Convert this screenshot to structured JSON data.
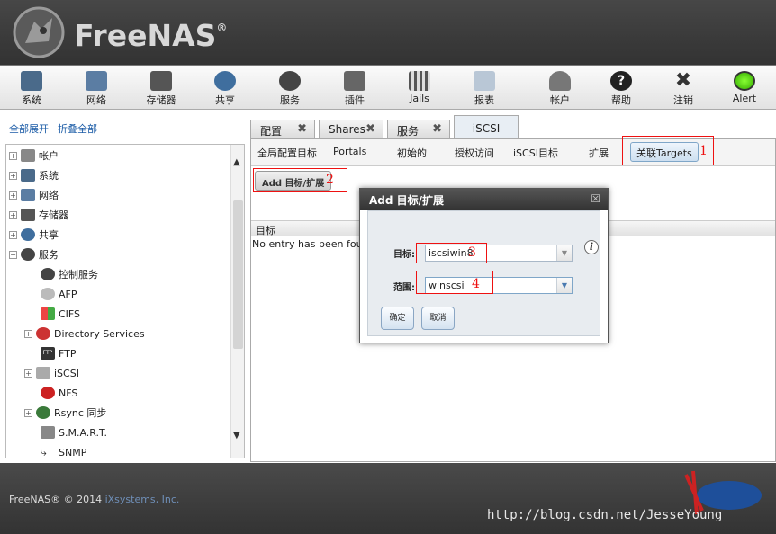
{
  "app": {
    "name": "FreeNAS",
    "reg": "®"
  },
  "toolbar": [
    {
      "label": "系统",
      "icon": "system-icon"
    },
    {
      "label": "网络",
      "icon": "network-icon"
    },
    {
      "label": "存储器",
      "icon": "storage-icon"
    },
    {
      "label": "共享",
      "icon": "sharing-icon"
    },
    {
      "label": "服务",
      "icon": "services-icon"
    },
    {
      "label": "插件",
      "icon": "plugins-icon"
    },
    {
      "label": "Jails",
      "icon": "jails-icon"
    },
    {
      "label": "报表",
      "icon": "reporting-icon"
    },
    {
      "label": "帐户",
      "icon": "account-icon"
    },
    {
      "label": "帮助",
      "icon": "help-icon"
    },
    {
      "label": "注销",
      "icon": "logout-icon"
    },
    {
      "label": "Alert",
      "icon": "alert-icon"
    }
  ],
  "sidebar": {
    "expand_all": "全部展开",
    "collapse_all": "折叠全部",
    "tree": [
      "帐户",
      "系统",
      "网络",
      "存储器",
      "共享",
      "服务",
      "控制服务",
      "AFP",
      "CIFS",
      "Directory Services",
      "FTP",
      "iSCSI",
      "NFS",
      "Rsync 同步",
      "S.M.A.R.T.",
      "SNMP"
    ]
  },
  "tabs": [
    "配置",
    "Shares",
    "服务",
    "iSCSI"
  ],
  "subtabs": [
    "全局配置目标",
    "Portals",
    "初始的",
    "授权访问",
    "iSCSI目标",
    "扩展",
    "关联Targets"
  ],
  "add_button": "Add 目标/扩展",
  "grid": {
    "header": "目标",
    "empty": "No entry has been fou"
  },
  "modal": {
    "title": "Add 目标/扩展",
    "close": "☒",
    "target_label": "目标:",
    "target_value": "iscsiwin8",
    "extent_label": "范围:",
    "extent_value": "winscsi",
    "ok": "确定",
    "cancel": "取消"
  },
  "annotations": [
    "1",
    "2",
    "3",
    "4"
  ],
  "footer": {
    "text": "FreeNAS® © 2014 ",
    "company": "iXsystems, Inc."
  },
  "watermark": "http://blog.csdn.net/JesseYoung",
  "colors": {
    "header": "#3a3a3a",
    "link": "#1a5ba6",
    "annotation": "#ee1111"
  }
}
